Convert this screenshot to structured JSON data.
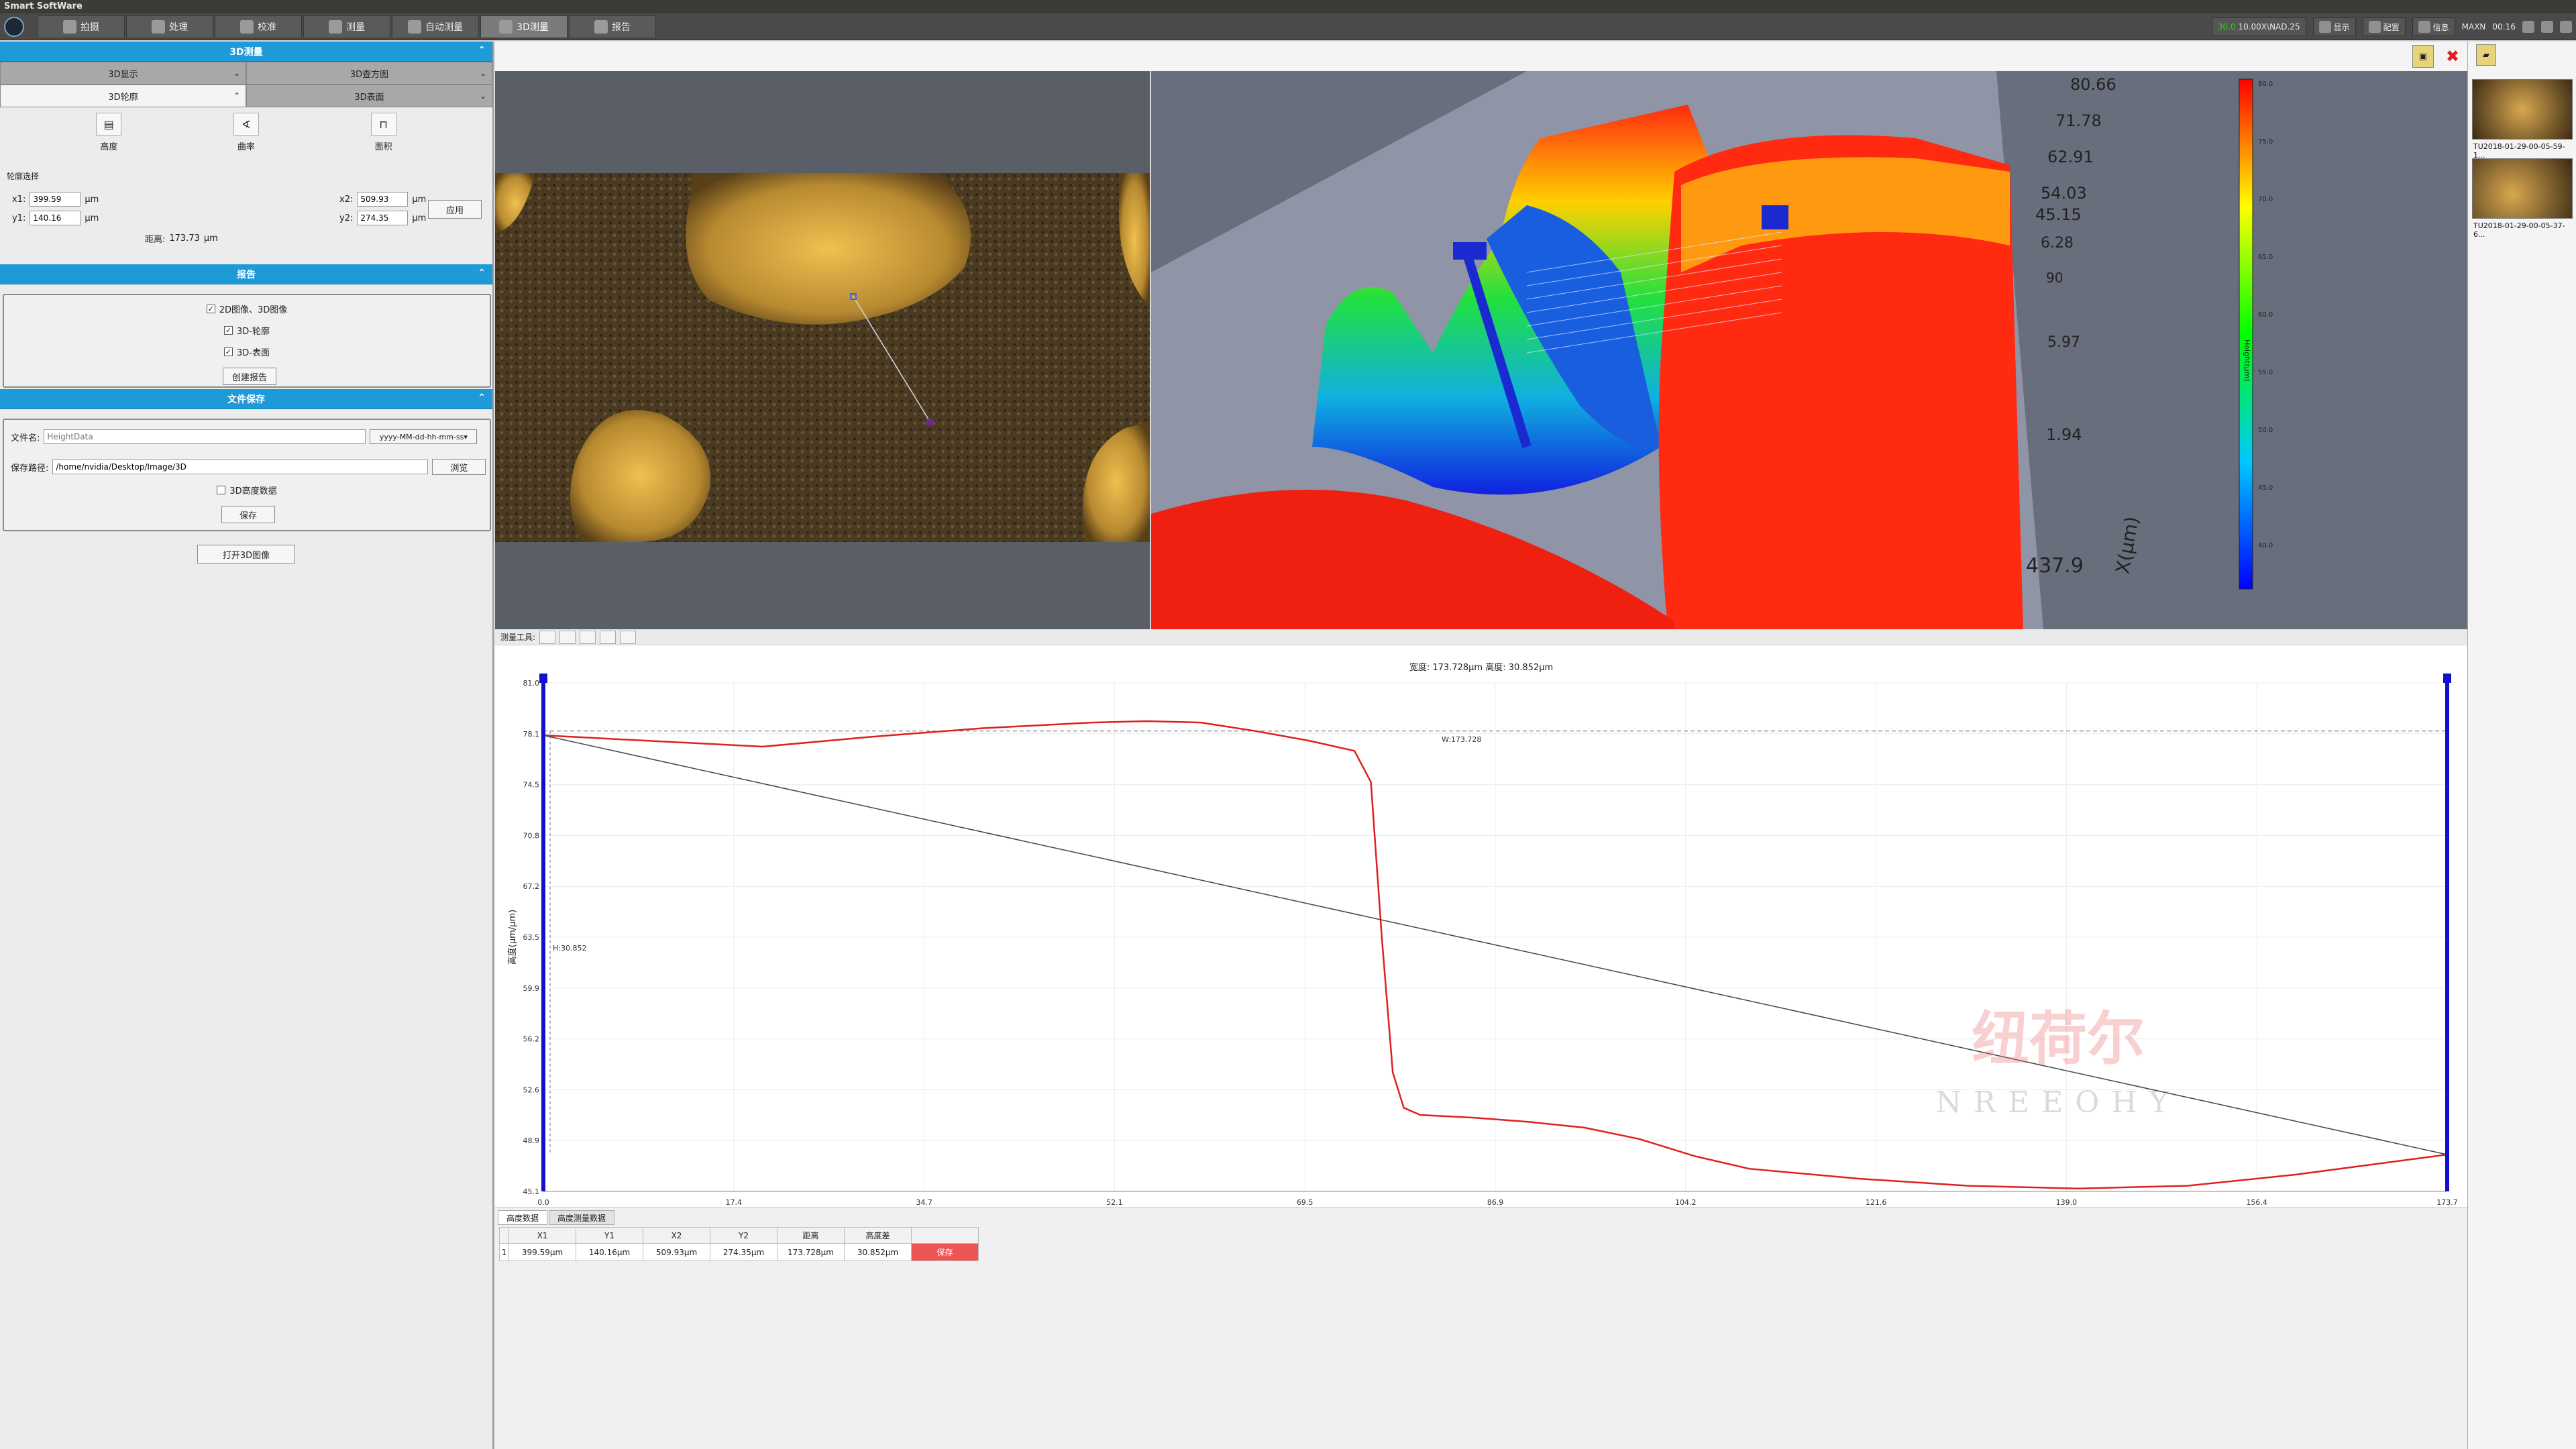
{
  "window": {
    "title": "Smart SoftWare"
  },
  "tabs": [
    {
      "label": "拍摄",
      "icon": "camera-icon"
    },
    {
      "label": "处理",
      "icon": "image-process-icon"
    },
    {
      "label": "校准",
      "icon": "ruler-icon"
    },
    {
      "label": "测量",
      "icon": "measure-icon"
    },
    {
      "label": "自动测量",
      "icon": "auto-measure-icon"
    },
    {
      "label": "3D测量",
      "icon": "cube-icon"
    },
    {
      "label": "报告",
      "icon": "report-icon"
    }
  ],
  "system": {
    "fps": "30.0",
    "status_text": "10.00X\\NAD.25",
    "show": "显示",
    "config": "配置",
    "info": "信息",
    "user": "MAXN",
    "clock": "00:16"
  },
  "left": {
    "measure_section": "3D测量",
    "subtabs_row1": [
      "3D显示",
      "3D查方图"
    ],
    "subtabs_row2": [
      "3D轮廓",
      "3D表面"
    ],
    "tools": [
      {
        "label": "高度",
        "icon": "height-icon"
      },
      {
        "label": "曲率",
        "icon": "curvature-icon"
      },
      {
        "label": "面积",
        "icon": "area-icon"
      }
    ],
    "profile_select_label": "轮廓选择",
    "x1_label": "x1:",
    "x1": "399.59",
    "y1_label": "y1:",
    "y1": "140.16",
    "x2_label": "x2:",
    "x2": "509.93",
    "y2_label": "y2:",
    "y2": "274.35",
    "unit": "μm",
    "apply": "应用",
    "distance_label": "距离:",
    "distance": "173.73",
    "distance_unit": "μm",
    "report_section": "报告",
    "report_checks": [
      "2D图像、3D图像",
      "3D-轮廓",
      "3D-表面"
    ],
    "create_report": "创建报告",
    "file_section": "文件保存",
    "filename_label": "文件名:",
    "filename_placeholder": "HeightData",
    "filename_format": "yyyy-MM-dd-hh-mm-ss",
    "path_label": "保存路径:",
    "path": "/home/nvidia/Desktop/Image/3D",
    "browse": "浏览",
    "save_height_data": "3D高度数据",
    "save": "保存",
    "open_3d": "打开3D图像"
  },
  "view3d": {
    "z_labels": [
      "80.66",
      "71.78",
      "62.91",
      "54.03",
      "45.15",
      "6.28",
      "90",
      "5.97",
      "1.94",
      "437.9"
    ],
    "axis_x": "X(μm)",
    "colorbar_ticks": [
      "80.0",
      "75.0",
      "70.0",
      "65.0",
      "60.0",
      "55.0",
      "50.0",
      "45.0",
      "40.0"
    ],
    "colorbar_label": "Height(μm)"
  },
  "profile": {
    "tool_label": "测量工具:",
    "header": "宽度: 173.728μm 高度: 30.852μm",
    "w_label": "W:173.728",
    "h_label": "H:30.852",
    "ylabel": "高度(μm/μm)",
    "xlabel": "μm",
    "watermark_cn": "纽荷尔",
    "watermark_en": "NREEOHY"
  },
  "chart_data": {
    "type": "line",
    "xlabel": "μm",
    "ylabel": "高度(μm/μm)",
    "xlim": [
      0.0,
      173.7
    ],
    "ylim": [
      45.1,
      81.0
    ],
    "x_ticks": [
      "0.0",
      "17.4",
      "34.7",
      "52.1",
      "69.5",
      "86.9",
      "104.2",
      "121.6",
      "139.0",
      "156.4",
      "173.7"
    ],
    "y_ticks": [
      "81.0",
      "78.1",
      "74.5",
      "70.8",
      "67.2",
      "63.5",
      "59.9",
      "56.2",
      "52.6",
      "48.9",
      "45.1"
    ],
    "series": [
      {
        "color": "#e02020",
        "x": [
          0,
          10,
          20,
          30,
          40,
          50,
          55,
          60,
          65,
          70,
          74,
          75.5,
          76.5,
          77.5,
          78.5,
          80,
          85,
          90,
          95,
          100,
          105,
          110,
          120,
          130,
          140,
          150,
          160,
          173.7
        ],
        "y": [
          77.3,
          76.9,
          76.5,
          77.2,
          77.8,
          78.2,
          78.3,
          78.2,
          77.6,
          76.9,
          76.2,
          74.0,
          63.0,
          53.5,
          51.0,
          50.5,
          50.3,
          50.0,
          49.6,
          48.8,
          47.6,
          46.7,
          46.0,
          45.5,
          45.3,
          45.5,
          46.3,
          47.7
        ]
      },
      {
        "color": "#444444",
        "x": [
          0,
          173.7
        ],
        "y": [
          77.3,
          47.7
        ]
      }
    ],
    "reference_y": 77.6
  },
  "table": {
    "tabs": [
      "高度数据",
      "高度测量数据"
    ],
    "headers": [
      "X1",
      "Y1",
      "X2",
      "Y2",
      "距离",
      "高度差"
    ],
    "rows": [
      [
        "1",
        "399.59μm",
        "140.16μm",
        "509.93μm",
        "274.35μm",
        "173.728μm",
        "30.852μm"
      ]
    ],
    "row_save": "保存"
  },
  "thumbnails": [
    "TU2018-01-29-00-05-59-1...",
    "TU2018-01-29-00-05-37-6..."
  ]
}
